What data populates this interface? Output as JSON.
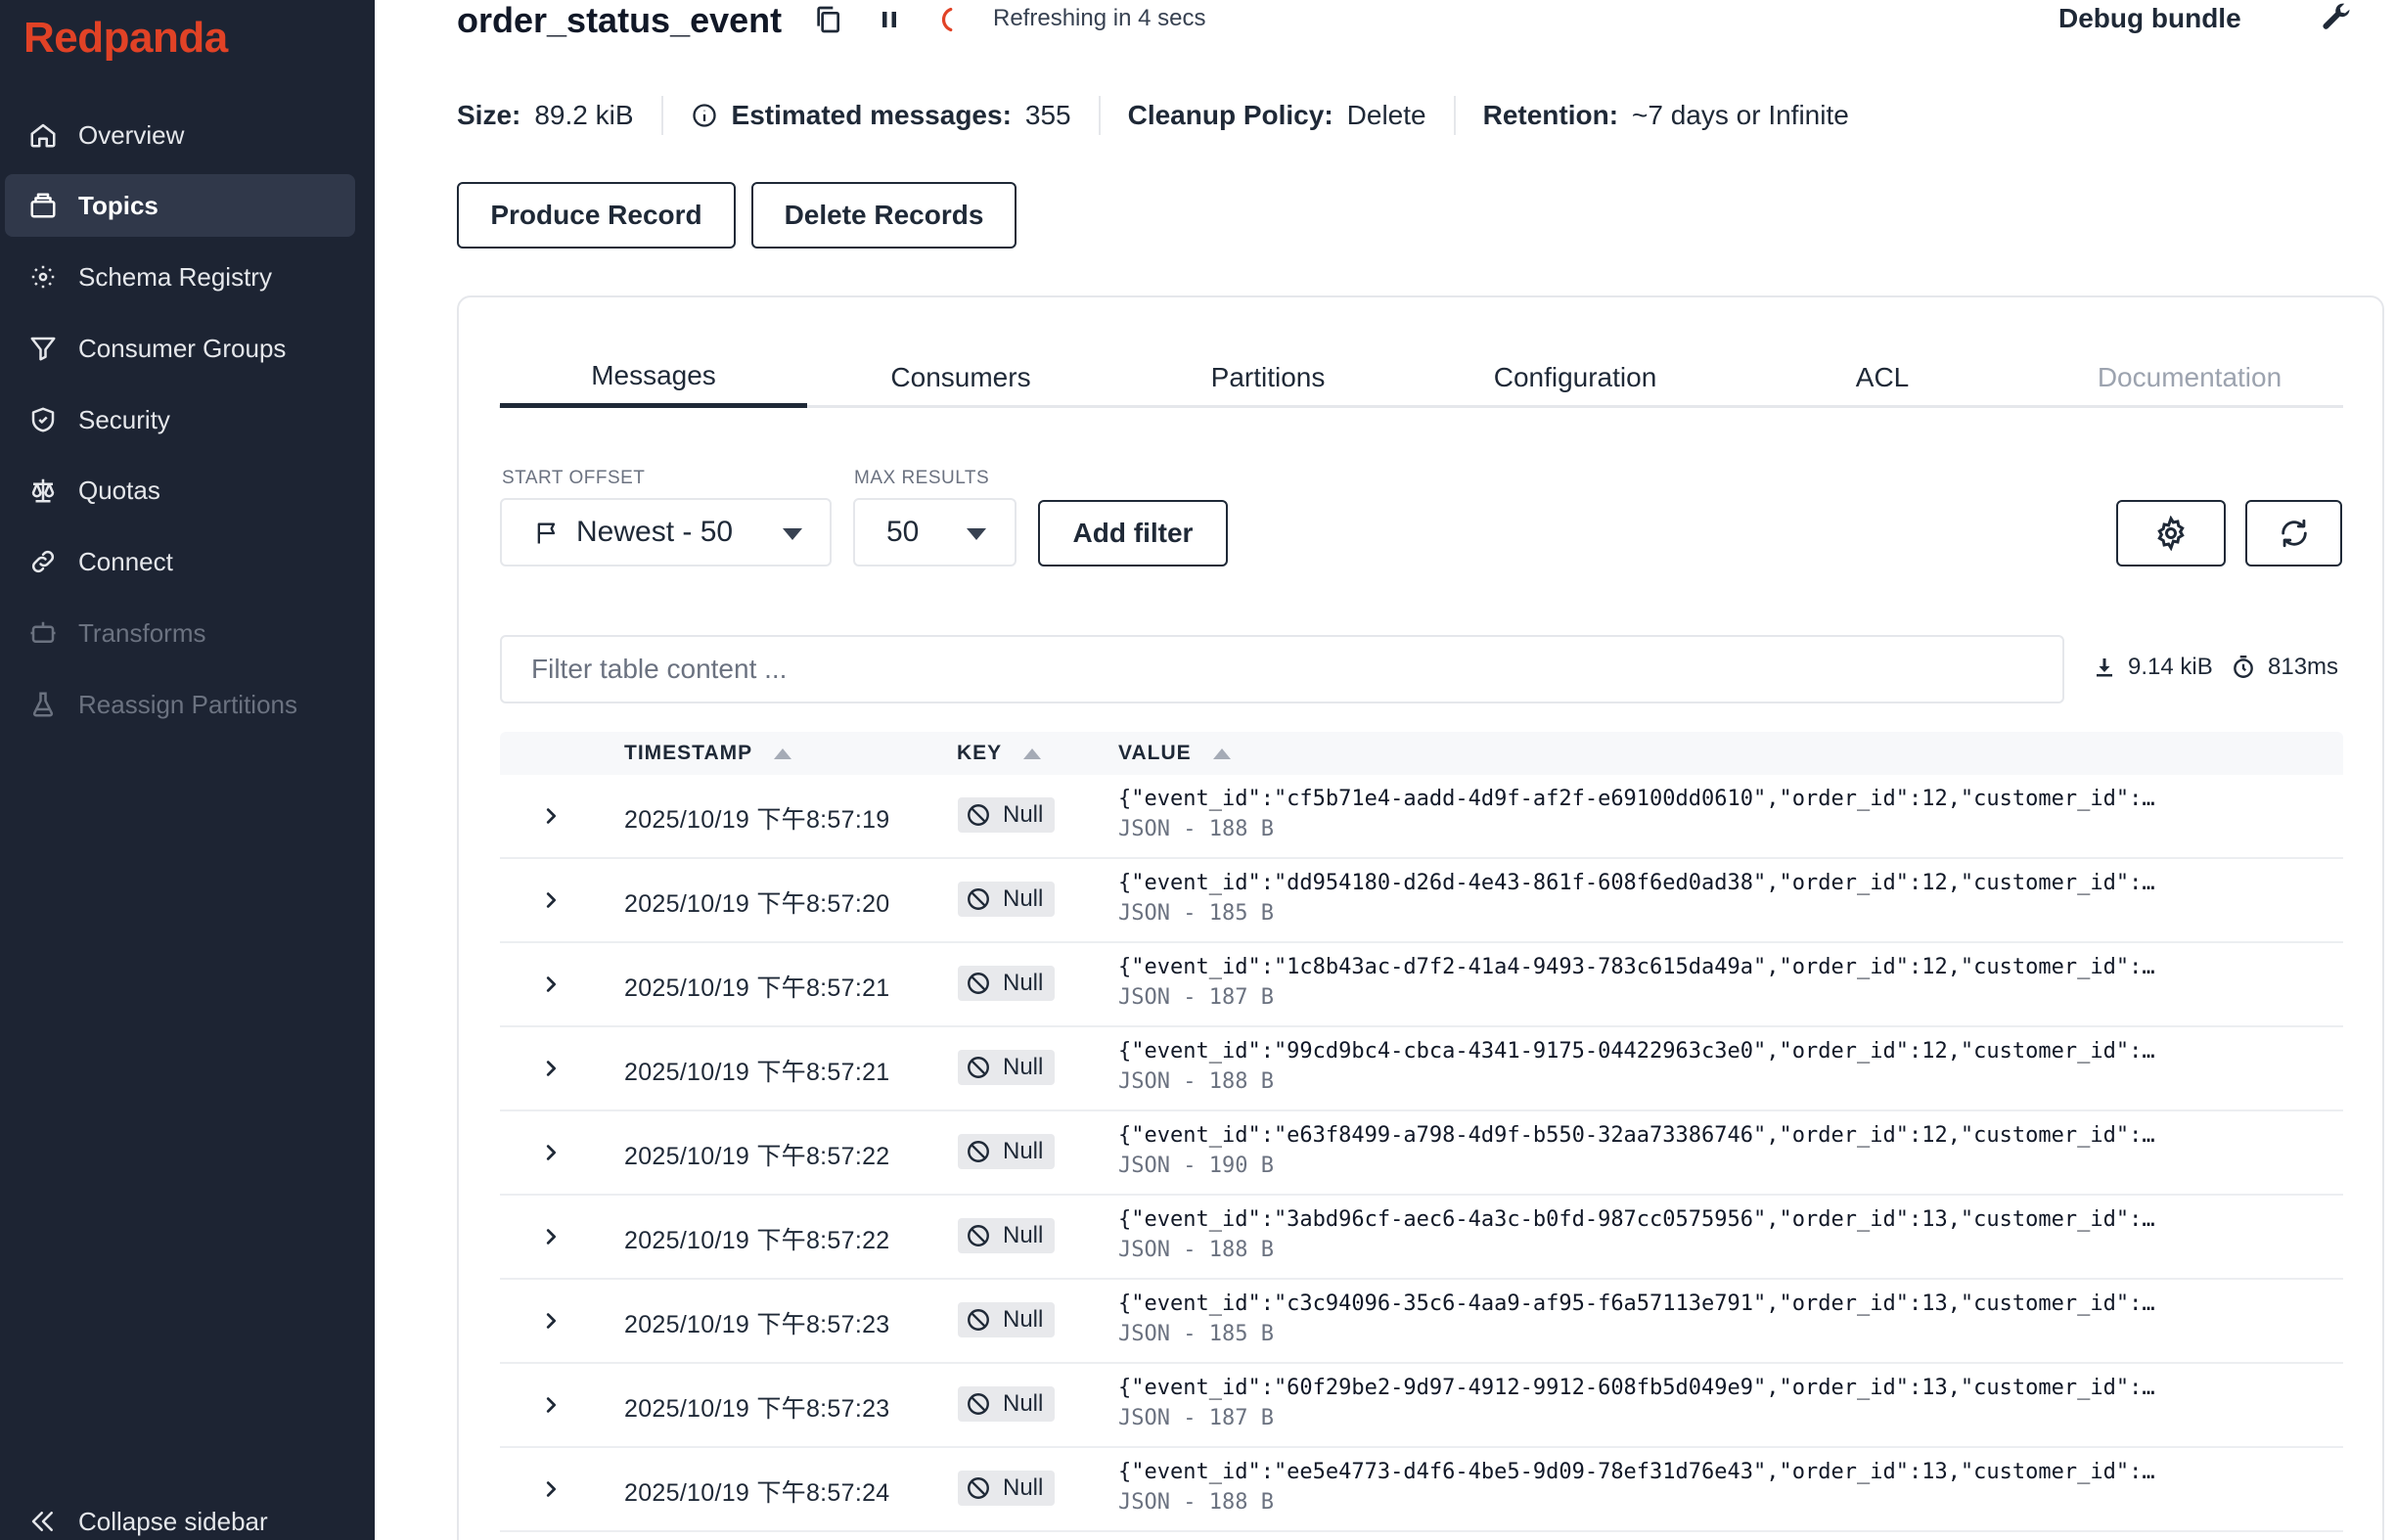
{
  "sidebar": {
    "logo": "Redpanda",
    "items": [
      {
        "label": "Overview",
        "icon": "home-icon"
      },
      {
        "label": "Topics",
        "icon": "topics-icon"
      },
      {
        "label": "Schema Registry",
        "icon": "schema-icon"
      },
      {
        "label": "Consumer Groups",
        "icon": "filter-icon"
      },
      {
        "label": "Security",
        "icon": "shield-icon"
      },
      {
        "label": "Quotas",
        "icon": "scale-icon"
      },
      {
        "label": "Connect",
        "icon": "link-icon"
      },
      {
        "label": "Transforms",
        "icon": "robot-icon"
      },
      {
        "label": "Reassign Partitions",
        "icon": "flask-icon"
      }
    ],
    "active": "Topics",
    "collapse_label": "Collapse sidebar"
  },
  "header": {
    "title": "order_status_event",
    "refresh_text": "Refreshing in 4 secs",
    "debug_label": "Debug bundle"
  },
  "stats": {
    "size_label": "Size:",
    "size_value": "89.2 kiB",
    "messages_label": "Estimated messages:",
    "messages_value": "355",
    "cleanup_label": "Cleanup Policy:",
    "cleanup_value": "Delete",
    "retention_label": "Retention:",
    "retention_value": "~7 days or Infinite"
  },
  "actions": {
    "produce_label": "Produce Record",
    "delete_label": "Delete Records"
  },
  "tabs": [
    {
      "label": "Messages",
      "state": "active"
    },
    {
      "label": "Consumers",
      "state": "normal"
    },
    {
      "label": "Partitions",
      "state": "normal"
    },
    {
      "label": "Configuration",
      "state": "normal"
    },
    {
      "label": "ACL",
      "state": "normal"
    },
    {
      "label": "Documentation",
      "state": "disabled"
    }
  ],
  "controls": {
    "start_offset_label": "START OFFSET",
    "start_offset_value": "Newest - 50",
    "max_results_label": "MAX RESULTS",
    "max_results_value": "50",
    "add_filter_label": "Add filter"
  },
  "search": {
    "placeholder": "Filter table content ..."
  },
  "metrics": {
    "download_size": "9.14 kiB",
    "duration": "813ms"
  },
  "table": {
    "columns": [
      "TIMESTAMP",
      "KEY",
      "VALUE"
    ],
    "rows": [
      {
        "timestamp": "2025/10/19 下午8:57:19",
        "key": "Null",
        "value": "{\"event_id\":\"cf5b71e4-aadd-4d9f-af2f-e69100dd0610\",\"order_id\":12,\"customer_id\":…",
        "meta": "JSON - 188 B"
      },
      {
        "timestamp": "2025/10/19 下午8:57:20",
        "key": "Null",
        "value": "{\"event_id\":\"dd954180-d26d-4e43-861f-608f6ed0ad38\",\"order_id\":12,\"customer_id\":…",
        "meta": "JSON - 185 B"
      },
      {
        "timestamp": "2025/10/19 下午8:57:21",
        "key": "Null",
        "value": "{\"event_id\":\"1c8b43ac-d7f2-41a4-9493-783c615da49a\",\"order_id\":12,\"customer_id\":…",
        "meta": "JSON - 187 B"
      },
      {
        "timestamp": "2025/10/19 下午8:57:21",
        "key": "Null",
        "value": "{\"event_id\":\"99cd9bc4-cbca-4341-9175-04422963c3e0\",\"order_id\":12,\"customer_id\":…",
        "meta": "JSON - 188 B"
      },
      {
        "timestamp": "2025/10/19 下午8:57:22",
        "key": "Null",
        "value": "{\"event_id\":\"e63f8499-a798-4d9f-b550-32aa73386746\",\"order_id\":12,\"customer_id\":…",
        "meta": "JSON - 190 B"
      },
      {
        "timestamp": "2025/10/19 下午8:57:22",
        "key": "Null",
        "value": "{\"event_id\":\"3abd96cf-aec6-4a3c-b0fd-987cc0575956\",\"order_id\":13,\"customer_id\":…",
        "meta": "JSON - 188 B"
      },
      {
        "timestamp": "2025/10/19 下午8:57:23",
        "key": "Null",
        "value": "{\"event_id\":\"c3c94096-35c6-4aa9-af95-f6a57113e791\",\"order_id\":13,\"customer_id\":…",
        "meta": "JSON - 185 B"
      },
      {
        "timestamp": "2025/10/19 下午8:57:23",
        "key": "Null",
        "value": "{\"event_id\":\"60f29be2-9d97-4912-9912-608fb5d049e9\",\"order_id\":13,\"customer_id\":…",
        "meta": "JSON - 187 B"
      },
      {
        "timestamp": "2025/10/19 下午8:57:24",
        "key": "Null",
        "value": "{\"event_id\":\"ee5e4773-d4f6-4be5-9d09-78ef31d76e43\",\"order_id\":13,\"customer_id\":…",
        "meta": "JSON - 188 B"
      }
    ]
  },
  "colors": {
    "brand": "#e14226",
    "sidebar_bg": "#1d2433",
    "refresh_spinner": "#e14226"
  }
}
